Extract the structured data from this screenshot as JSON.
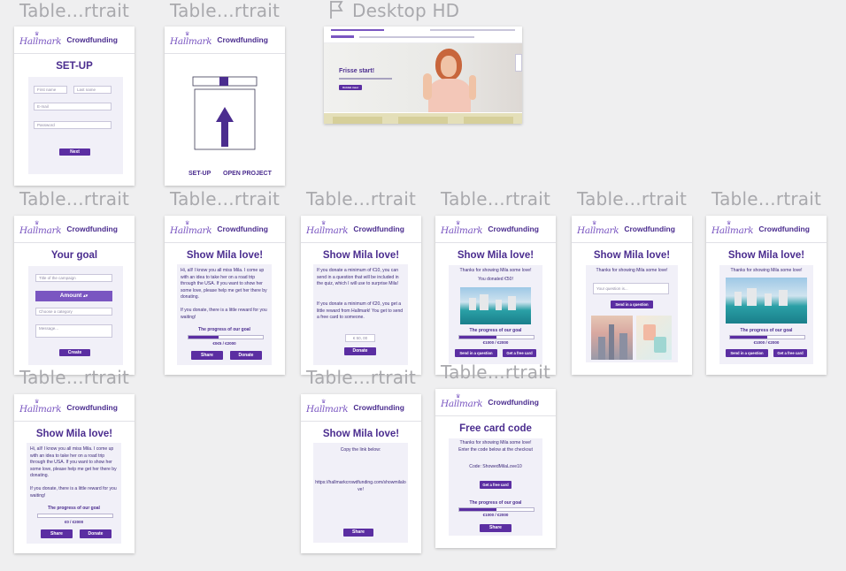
{
  "canvas": {
    "frame_label": "Table…rtrait",
    "desktop_label": "Desktop HD",
    "background": "#efeff0"
  },
  "brand": {
    "logo": "Hallmark",
    "product": "Crowdfunding",
    "accent": "#5b2ea2",
    "title_color": "#4b2d8f"
  },
  "frames": {
    "setup": {
      "title": "SET-UP",
      "first_name": "First name",
      "last_name": "Last name",
      "email": "E-mail",
      "password": "Password",
      "next": "Next"
    },
    "start": {
      "setup_link": "SET-UP",
      "open_link": "OPEN PROJECT"
    },
    "desktop": {
      "hero_title": "Frisse start!",
      "hero_button": "Ontdek meer"
    },
    "goal": {
      "title": "Your goal",
      "campaign": "Title of the campaign",
      "amount": "Amount",
      "category": "Choose a category",
      "message": "Message...",
      "create": "Create"
    },
    "love1": {
      "title": "Show Mila love!",
      "para1": "Hi, all! I know you all miss Mila. I come up with an idea to take her on a road trip through the USA. If you want to show her some love, please help me get her there by donating.",
      "para2": "If you donate, there is a little reward for you waiting!",
      "progress_label": "The progress of our goal",
      "progress_amount": "€0€5 / €2000",
      "share": "Share",
      "donate": "Donate"
    },
    "donate_info": {
      "title": "Show Mila love!",
      "para1": "If you donate a minimum of €10, you can send in a question that will be included in the quiz, which I will use to surprise Mila!",
      "para2": "If you donate a minimum of €20, you get a little reward from Hallmark! You get to send a free card to someone.",
      "amount_placeholder": "€ 50, 00",
      "donate": "Donate"
    },
    "thanks1": {
      "title": "Show Mila love!",
      "thanks": "Thanks for showing Mila some love!",
      "donated": "You donated €50!",
      "progress_label": "The progress of our goal",
      "progress_amount": "€1000 / €2000",
      "question_btn": "Send in a question",
      "card_btn": "Get a free card"
    },
    "question": {
      "title": "Show Mila love!",
      "thanks": "Thanks for showing Mila some love!",
      "placeholder": "Your question is...",
      "send": "Send in a question"
    },
    "thanks2": {
      "title": "Show Mila love!",
      "thanks": "Thanks for showing Mila some love!",
      "progress_label": "The progress of our goal",
      "progress_amount": "€1000 / €2000",
      "question_btn": "Send in a question",
      "card_btn": "Get a free card"
    },
    "love2": {
      "title": "Show Mila love!",
      "para1": "Hi, all! I know you all miss Mila. I come up with an idea to take her on a road trip through the USA. If you want to show her some love, please help me get her there by donating.",
      "para2": "If you donate, there is a little reward for you waiting!",
      "progress_label": "The progress of our goal",
      "progress_amount": "€0 / €2000",
      "share": "Share",
      "donate": "Donate"
    },
    "share_link": {
      "title": "Show Mila love!",
      "copy": "Copy the link below:",
      "link": "https://hallmarkcrowdfunding.com/showmilalove!",
      "share": "Share"
    },
    "free_card": {
      "title": "Free card code",
      "line1": "Thanks for showing Mila some love!",
      "line2": "Enter the code below at the checkout",
      "code": "Code: ShowedMilaLove10",
      "get_card": "Get a free card",
      "progress_label": "The progress of our goal",
      "progress_amount": "€1000 / €2000",
      "share": "Share"
    }
  },
  "progress": {
    "love1": 0.4,
    "thanks1": 0.5,
    "thanks2": 0.5,
    "love2": 0.0,
    "free_card": 0.5
  }
}
